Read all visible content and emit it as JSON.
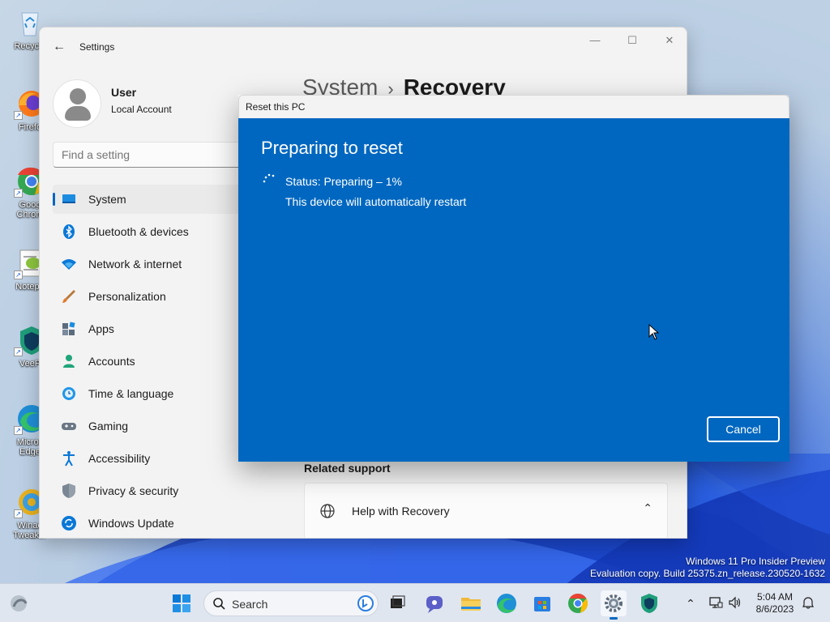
{
  "desktop": {
    "icons": [
      {
        "label": "Recycle",
        "icon": "recycle-bin-icon"
      },
      {
        "label": "Firefo",
        "icon": "firefox-icon"
      },
      {
        "label": "Goog",
        "label2": "Chrom",
        "icon": "chrome-icon"
      },
      {
        "label": "Notepa",
        "icon": "notepad-icon"
      },
      {
        "label": "VeeP",
        "icon": "veepn-icon"
      },
      {
        "label": "Micros",
        "label2": "Edge",
        "icon": "edge-icon"
      },
      {
        "label": "Winae",
        "label2": "Tweaker",
        "icon": "winaero-tweaker-icon"
      }
    ],
    "watermark_line1": "Windows 11 Pro Insider Preview",
    "watermark_line2": "Evaluation copy. Build 25375.zn_release.230520-1632"
  },
  "settings": {
    "app_title": "Settings",
    "controls": {
      "minimize": "—",
      "maximize": "☐",
      "close": "✕"
    },
    "user": {
      "name": "User",
      "account_type": "Local Account"
    },
    "search_placeholder": "Find a setting",
    "nav": [
      {
        "label": "System",
        "icon": "system-icon",
        "active": true
      },
      {
        "label": "Bluetooth & devices",
        "icon": "bluetooth-icon"
      },
      {
        "label": "Network & internet",
        "icon": "network-icon"
      },
      {
        "label": "Personalization",
        "icon": "personalization-icon"
      },
      {
        "label": "Apps",
        "icon": "apps-icon"
      },
      {
        "label": "Accounts",
        "icon": "accounts-icon"
      },
      {
        "label": "Time & language",
        "icon": "time-language-icon"
      },
      {
        "label": "Gaming",
        "icon": "gaming-icon"
      },
      {
        "label": "Accessibility",
        "icon": "accessibility-icon"
      },
      {
        "label": "Privacy & security",
        "icon": "privacy-icon"
      },
      {
        "label": "Windows Update",
        "icon": "windows-update-icon"
      }
    ],
    "breadcrumb": {
      "parent": "System",
      "separator": "›",
      "current": "Recovery"
    },
    "related_support": {
      "heading": "Related support",
      "help_item": "Help with Recovery"
    }
  },
  "dialog": {
    "title": "Reset this PC",
    "heading": "Preparing to reset",
    "status": "Status: Preparing – 1%",
    "progress_percent": 1,
    "note": "This device will automatically restart",
    "cancel_label": "Cancel",
    "accent_color": "#0067c0"
  },
  "taskbar": {
    "search_label": "Search",
    "apps": [
      "widgets-icon",
      "start-icon",
      "search-icon",
      "task-view-icon",
      "chat-icon",
      "file-explorer-icon",
      "edge-icon",
      "store-icon",
      "chrome-icon",
      "settings-icon",
      "veepn-icon"
    ],
    "active_app": "settings-icon",
    "time": "5:04 AM",
    "date": "8/6/2023"
  }
}
